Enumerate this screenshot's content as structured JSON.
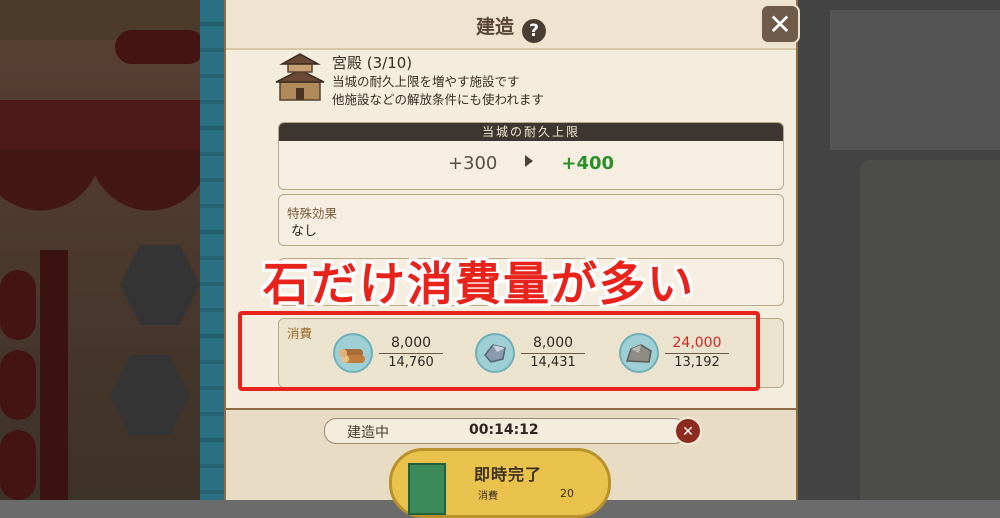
{
  "dialog": {
    "title": "建造",
    "help_icon": "?",
    "close_icon": "✕"
  },
  "building": {
    "name": "宮殿 (3/10)",
    "desc_line1": "当城の耐久上限を増やす施設です",
    "desc_line2": "他施設などの解放条件にも使われます"
  },
  "stat": {
    "header": "当城の耐久上限",
    "current": "+300",
    "next": "+400"
  },
  "effect": {
    "label": "特殊効果",
    "value": "なし"
  },
  "cost": {
    "label": "消費",
    "resources": [
      {
        "icon": "wood-icon",
        "need": "8,000",
        "have": "14,760",
        "short": false
      },
      {
        "icon": "iron-icon",
        "need": "8,000",
        "have": "14,431",
        "short": false
      },
      {
        "icon": "stone-icon",
        "need": "24,000",
        "have": "13,192",
        "short": true
      }
    ]
  },
  "annotation": {
    "caption": "石だけ消費量が多い",
    "color": "#e8231c"
  },
  "construction": {
    "status_label": "建造中",
    "timer": "00:14:12",
    "instant_label": "即時完了",
    "instant_cost_label": "消費",
    "instant_cost_value": "20"
  }
}
